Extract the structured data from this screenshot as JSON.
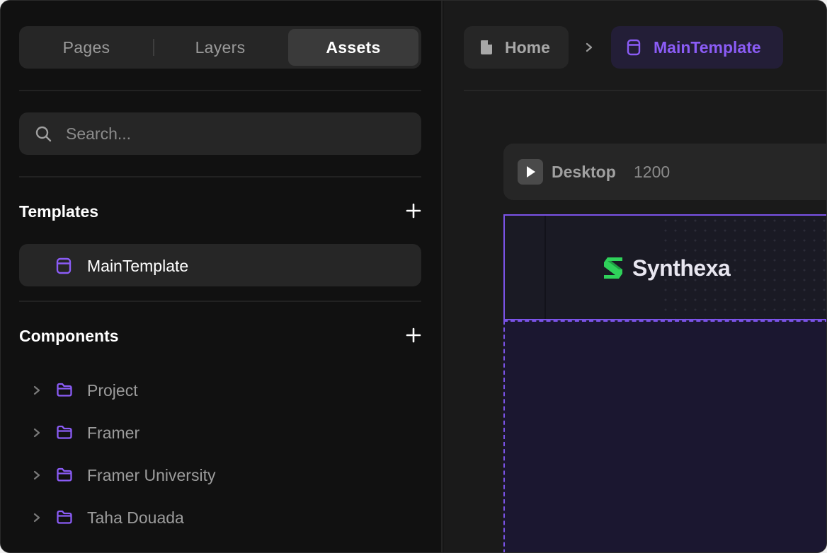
{
  "sidebar": {
    "tabs": [
      {
        "label": "Pages",
        "active": false
      },
      {
        "label": "Layers",
        "active": false
      },
      {
        "label": "Assets",
        "active": true
      }
    ],
    "search": {
      "placeholder": "Search..."
    },
    "templates": {
      "title": "Templates",
      "items": [
        {
          "label": "MainTemplate",
          "icon": "template-icon"
        }
      ]
    },
    "components": {
      "title": "Components",
      "items": [
        {
          "label": "Project",
          "icon": "folder-icon"
        },
        {
          "label": "Framer",
          "icon": "folder-icon"
        },
        {
          "label": "Framer University",
          "icon": "folder-icon"
        },
        {
          "label": "Taha Douada",
          "icon": "folder-icon"
        }
      ]
    }
  },
  "breadcrumb": {
    "home": {
      "label": "Home",
      "icon": "page-icon"
    },
    "current": {
      "label": "MainTemplate",
      "icon": "template-icon"
    }
  },
  "canvas": {
    "breakpoint": {
      "name": "Desktop",
      "width": "1200"
    },
    "logo": {
      "text": "Synthexa"
    }
  },
  "colors": {
    "accent": "#8b5cf6",
    "selection": "#7b53e8",
    "logo_green": "#2fd15a",
    "background": "#111111"
  }
}
